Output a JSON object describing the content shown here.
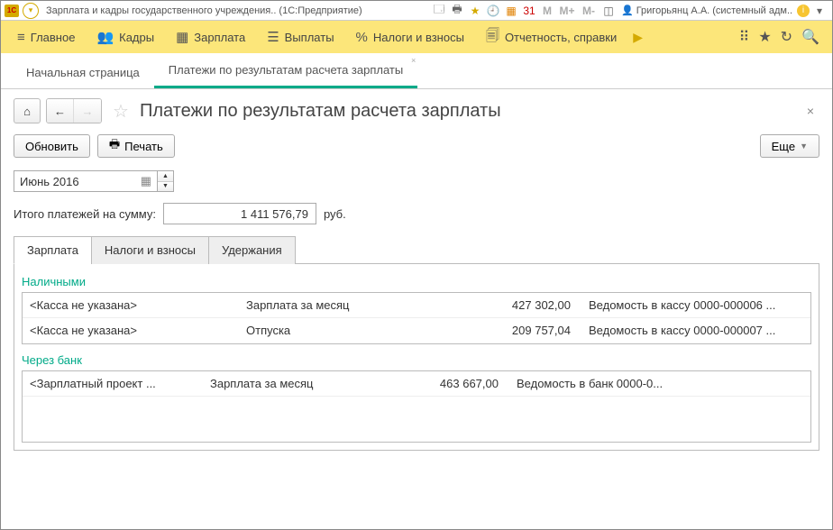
{
  "titlebar": {
    "app_title": "Зарплата и кадры государственного учреждения.. (1С:Предприятие)",
    "m_label": "M",
    "mplus_label": "M+",
    "mminus_label": "M-",
    "user_name": "Григорьянц А.А. (системный адм..."
  },
  "maintb": {
    "items": [
      {
        "icon": "≡",
        "label": "Главное"
      },
      {
        "icon": "👥",
        "label": "Кадры"
      },
      {
        "icon": "▦",
        "label": "Зарплата"
      },
      {
        "icon": "☰",
        "label": "Выплаты"
      },
      {
        "icon": "%",
        "label": "Налоги и взносы"
      },
      {
        "icon": "🗐",
        "label": "Отчетность, справки"
      }
    ]
  },
  "tabs": {
    "start": "Начальная страница",
    "active": "Платежи по результатам расчета зарплаты"
  },
  "header": {
    "page_title": "Платежи по результатам расчета зарплаты"
  },
  "actions": {
    "refresh": "Обновить",
    "print": "Печать",
    "more": "Еще"
  },
  "period": {
    "value": "Июнь 2016"
  },
  "total": {
    "label": "Итого платежей на сумму:",
    "value": "1 411 576,79",
    "currency": "руб."
  },
  "innertabs": {
    "salary": "Зарплата",
    "taxes": "Налоги и взносы",
    "deductions": "Удержания"
  },
  "sections": {
    "cash_label": "Наличными",
    "bank_label": "Через банк"
  },
  "cash_rows": [
    {
      "c1": "<Касса не указана>",
      "c2": "Зарплата за месяц",
      "c3": "427 302,00",
      "c4": "Ведомость в кассу 0000-000006 ..."
    },
    {
      "c1": "<Касса не указана>",
      "c2": "Отпуска",
      "c3": "209 757,04",
      "c4": "Ведомость в кассу 0000-000007 ..."
    }
  ],
  "bank_rows": [
    {
      "c1": "<Зарплатный проект ...",
      "c2": "Зарплата за месяц",
      "c3": "463 667,00",
      "c4": "Ведомость в банк 0000-0..."
    }
  ]
}
